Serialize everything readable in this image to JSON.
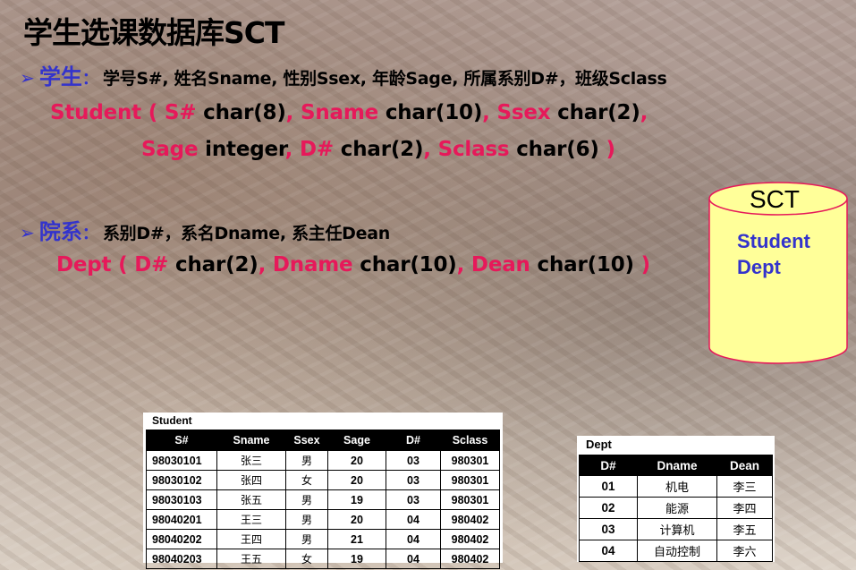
{
  "title": "学生选课数据库SCT",
  "student": {
    "heading": "学生",
    "colon": "：",
    "desc": "学号S#, 姓名Sname, 性别Ssex, 年龄Sage, 所属系别D#，班级Sclass",
    "line1": {
      "p1": "Student ( S#",
      "p2": " char(8)",
      "p3": ", Sname",
      "p4": "  char(10)",
      "p5": ",  Ssex",
      "p6": " char(2)",
      "p7": ","
    },
    "line2": {
      "p1": "Sage",
      "p2": "  integer",
      "p3": ",  D#",
      "p4": "  char(2)",
      "p5": ", Sclass",
      "p6": "  char(6)",
      "p7": " )"
    }
  },
  "dept": {
    "heading": "院系",
    "colon": "：",
    "desc": "系别D#，系名Dname, 系主任Dean",
    "line1": {
      "p1": "Dept ( D#",
      "p2": "  char(2)",
      "p3": ", Dname",
      "p4": "   char(10)",
      "p5": ",  Dean",
      "p6": "  char(10)",
      "p7": " )"
    }
  },
  "cylinder": {
    "label": "SCT",
    "items": [
      "Student",
      "Dept"
    ],
    "fill": "#ffff99",
    "stroke": "#e6195a"
  },
  "student_table": {
    "caption": "Student",
    "headers": [
      "S#",
      "Sname",
      "Ssex",
      "Sage",
      "D#",
      "Sclass"
    ],
    "rows": [
      [
        "98030101",
        "张三",
        "男",
        "20",
        "03",
        "980301"
      ],
      [
        "98030102",
        "张四",
        "女",
        "20",
        "03",
        "980301"
      ],
      [
        "98030103",
        "张五",
        "男",
        "19",
        "03",
        "980301"
      ],
      [
        "98040201",
        "王三",
        "男",
        "20",
        "04",
        "980402"
      ],
      [
        "98040202",
        "王四",
        "男",
        "21",
        "04",
        "980402"
      ],
      [
        "98040203",
        "王五",
        "女",
        "19",
        "04",
        "980402"
      ]
    ]
  },
  "dept_table": {
    "caption": "Dept",
    "headers": [
      "D#",
      "Dname",
      "Dean"
    ],
    "rows": [
      [
        "01",
        "机电",
        "李三"
      ],
      [
        "02",
        "能源",
        "李四"
      ],
      [
        "03",
        "计算机",
        "李五"
      ],
      [
        "04",
        "自动控制",
        "李六"
      ]
    ]
  },
  "colors": {
    "accent_blue": "#3333cc",
    "accent_red": "#e6195a",
    "header_black": "#000000"
  }
}
